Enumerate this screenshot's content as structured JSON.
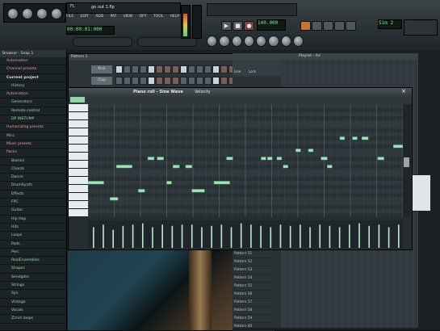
{
  "toolbar": {
    "file_menu": [
      "FILE",
      "EDIT",
      "ADD",
      "PAT",
      "VIEW",
      "OPT",
      "TOOL",
      "HELP"
    ],
    "project_title": "go out 1.flp",
    "hint": "00:00:01:000",
    "pattern_label": "Pattern 1",
    "tempo": "140.000",
    "pattern_number": "1",
    "lcd_small": "Sim 2"
  },
  "browser": {
    "title": "Browser - Snap 1",
    "items": [
      {
        "label": "Automation",
        "kind": "f"
      },
      {
        "label": "Channel presets",
        "kind": "f"
      },
      {
        "label": "Current project",
        "kind": "s"
      },
      {
        "label": "History",
        "kind": "n"
      },
      {
        "label": "Automation",
        "kind": "f"
      },
      {
        "label": "Generators",
        "kind": "n"
      },
      {
        "label": "Remote control",
        "kind": "n"
      },
      {
        "label": "DP INSTUMP",
        "kind": "n"
      },
      {
        "label": "Humanizing presets",
        "kind": "f"
      },
      {
        "label": "Misc",
        "kind": "f"
      },
      {
        "label": "Mixer presets",
        "kind": "f"
      },
      {
        "label": "Packs",
        "kind": "f"
      },
      {
        "label": "Basses",
        "kind": "n"
      },
      {
        "label": "Chords",
        "kind": "n"
      },
      {
        "label": "Dance",
        "kind": "n"
      },
      {
        "label": "DrumSynth",
        "kind": "n"
      },
      {
        "label": "Effects",
        "kind": "n"
      },
      {
        "label": "FPC",
        "kind": "n"
      },
      {
        "label": "Guitar",
        "kind": "n"
      },
      {
        "label": "Hip Hop",
        "kind": "n"
      },
      {
        "label": "Hits",
        "kind": "n"
      },
      {
        "label": "Loops",
        "kind": "n"
      },
      {
        "label": "Pads",
        "kind": "n"
      },
      {
        "label": "Perc",
        "kind": "n"
      },
      {
        "label": "RealEnsembles",
        "kind": "n"
      },
      {
        "label": "Shapes",
        "kind": "n"
      },
      {
        "label": "Sendgate",
        "kind": "n"
      },
      {
        "label": "Strings",
        "kind": "n"
      },
      {
        "label": "Syn",
        "kind": "n"
      },
      {
        "label": "Vintage",
        "kind": "n"
      },
      {
        "label": "Vocals",
        "kind": "n"
      },
      {
        "label": "Zimm loops",
        "kind": "n"
      }
    ]
  },
  "stepseq": {
    "title": "Pattern 1",
    "channels": [
      "Kick",
      "Clap"
    ]
  },
  "playlist": {
    "title": "Playlist - Arr",
    "tracks": [
      "Pattern 51",
      "Pattern 52",
      "Pattern 53",
      "Pattern 54",
      "Pattern 55",
      "Pattern 56",
      "Pattern 57",
      "Pattern 58",
      "Pattern 59",
      "Pattern 60"
    ],
    "col_labels": [
      "Line",
      "Lock"
    ]
  },
  "pianoroll": {
    "title": "Piano roll - Sine Wave",
    "subtitle": "Velocity",
    "notes": [
      {
        "start": 0.0,
        "len": 0.05,
        "pitch": 19
      },
      {
        "start": 0.07,
        "len": 0.025,
        "pitch": 23
      },
      {
        "start": 0.09,
        "len": 0.05,
        "pitch": 15
      },
      {
        "start": 0.16,
        "len": 0.02,
        "pitch": 21
      },
      {
        "start": 0.19,
        "len": 0.02,
        "pitch": 13
      },
      {
        "start": 0.22,
        "len": 0.02,
        "pitch": 13
      },
      {
        "start": 0.25,
        "len": 0.015,
        "pitch": 19
      },
      {
        "start": 0.27,
        "len": 0.02,
        "pitch": 15
      },
      {
        "start": 0.31,
        "len": 0.02,
        "pitch": 15
      },
      {
        "start": 0.33,
        "len": 0.04,
        "pitch": 21
      },
      {
        "start": 0.4,
        "len": 0.05,
        "pitch": 19
      },
      {
        "start": 0.44,
        "len": 0.02,
        "pitch": 13
      },
      {
        "start": 0.55,
        "len": 0.015,
        "pitch": 13
      },
      {
        "start": 0.57,
        "len": 0.015,
        "pitch": 13
      },
      {
        "start": 0.6,
        "len": 0.015,
        "pitch": 13
      },
      {
        "start": 0.62,
        "len": 0.015,
        "pitch": 15
      },
      {
        "start": 0.66,
        "len": 0.015,
        "pitch": 11
      },
      {
        "start": 0.7,
        "len": 0.015,
        "pitch": 11
      },
      {
        "start": 0.74,
        "len": 0.02,
        "pitch": 13
      },
      {
        "start": 0.76,
        "len": 0.015,
        "pitch": 15
      },
      {
        "start": 0.8,
        "len": 0.015,
        "pitch": 8
      },
      {
        "start": 0.84,
        "len": 0.015,
        "pitch": 8
      },
      {
        "start": 0.87,
        "len": 0.02,
        "pitch": 8
      },
      {
        "start": 0.92,
        "len": 0.02,
        "pitch": 13
      },
      {
        "start": 0.97,
        "len": 0.05,
        "pitch": 10
      }
    ],
    "velocities": [
      0.8,
      0.9,
      0.7,
      0.85,
      0.9,
      0.95,
      0.8,
      0.9,
      0.85,
      0.9,
      0.9,
      0.8,
      0.85,
      0.9,
      0.8,
      0.95,
      0.9,
      0.85,
      0.8,
      0.9,
      0.85,
      0.9,
      0.8,
      0.9,
      0.85,
      0.8,
      0.9,
      0.95,
      0.85,
      0.9,
      0.8,
      0.9
    ]
  }
}
